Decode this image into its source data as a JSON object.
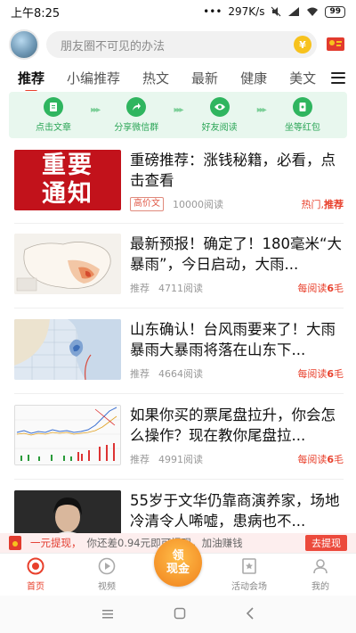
{
  "status_bar": {
    "time": "上午8:25",
    "dots": "•••",
    "speed": "297K/s",
    "battery": "99"
  },
  "search": {
    "placeholder": "朋友圈不可见的办法"
  },
  "tabs": [
    "推荐",
    "小编推荐",
    "热文",
    "最新",
    "健康",
    "美文"
  ],
  "steps": [
    {
      "label": "点击文章",
      "icon": "document-icon"
    },
    {
      "label": "分享微信群",
      "icon": "share-arrow-icon"
    },
    {
      "label": "好友阅读",
      "icon": "eye-icon"
    },
    {
      "label": "坐等红包",
      "icon": "red-packet-icon"
    }
  ],
  "articles": [
    {
      "title": "重磅推荐：涨钱秘籍，必看，点击查看",
      "thumb_text": [
        "重要",
        "通知"
      ],
      "tag": "高价文",
      "reads": "10000阅读",
      "reward_prefix": "热门,",
      "reward_value": "推荐",
      "reward_suffix": ""
    },
    {
      "title": "最新预报！确定了！180毫米“大暴雨”，今日启动，大雨...",
      "source": "推荐",
      "reads": "4711阅读",
      "reward_prefix": "每阅读",
      "reward_value": "6",
      "reward_suffix": "毛"
    },
    {
      "title": "山东确认！台风雨要来了！大雨暴雨大暴雨将落在山东下...",
      "source": "推荐",
      "reads": "4664阅读",
      "reward_prefix": "每阅读",
      "reward_value": "6",
      "reward_suffix": "毛"
    },
    {
      "title": "如果你买的票尾盘拉升，你会怎么操作？现在教你尾盘拉...",
      "source": "推荐",
      "reads": "4991阅读",
      "reward_prefix": "每阅读",
      "reward_value": "6",
      "reward_suffix": "毛"
    },
    {
      "title": "55岁于文华仍靠商演养家，场地冷清令人唏嘘，患病也不..."
    }
  ],
  "withdraw": {
    "title": "一元提现，",
    "desc": "你还差0.94元即可提现，加油赚钱",
    "button": "去提现"
  },
  "bottom_nav": {
    "home": "首页",
    "video": "视频",
    "center_top": "领",
    "center_bottom": "现金",
    "activity": "活动会场",
    "mine": "我的"
  },
  "colors": {
    "accent": "#e8402c",
    "green": "#2fb55f",
    "banner_bg": "#e8f7ee"
  }
}
